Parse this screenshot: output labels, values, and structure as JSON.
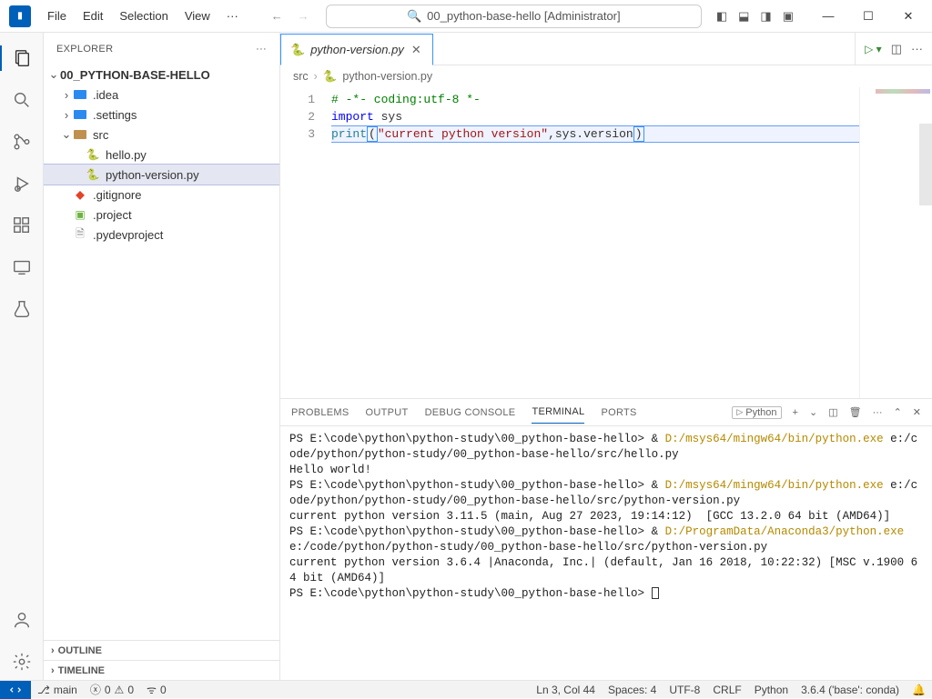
{
  "title": "00_python-base-hello [Administrator]",
  "menu": {
    "file": "File",
    "edit": "Edit",
    "selection": "Selection",
    "view": "View",
    "more": "···"
  },
  "sidebar": {
    "title": "EXPLORER",
    "root": "00_PYTHON-BASE-HELLO",
    "idea": ".idea",
    "settings": ".settings",
    "src": "src",
    "hello": "hello.py",
    "pyver": "python-version.py",
    "gitignore": ".gitignore",
    "project": ".project",
    "pydev": ".pydevproject",
    "outline": "OUTLINE",
    "timeline": "TIMELINE"
  },
  "tab": {
    "name": "python-version.py"
  },
  "breadcrumb": {
    "a": "src",
    "b": "python-version.py"
  },
  "editor": {
    "lines": [
      "1",
      "2",
      "3"
    ],
    "l1_comment": "# -*- coding:utf-8 *-",
    "l2_kw": "import",
    "l2_mod": " sys",
    "l3_fn": "print",
    "l3_open": "(",
    "l3_str": "\"current python version\"",
    "l3_mid": ",sys.version",
    "l3_close": ")"
  },
  "panel": {
    "problems": "PROBLEMS",
    "output": "OUTPUT",
    "debug": "DEBUG CONSOLE",
    "terminal": "TERMINAL",
    "ports": "PORTS",
    "launch": "Python",
    "plus": "+"
  },
  "terminal": {
    "p1a": "PS E:\\code\\python\\python-study\\00_python-base-hello> & ",
    "p1y": "D:/msys64/mingw64/bin/python.exe",
    "p1b": " e:/code/python/python-study/00_python-base-hello/src/hello.py",
    "o1": "Hello world!",
    "p2a": "PS E:\\code\\python\\python-study\\00_python-base-hello> & ",
    "p2y": "D:/msys64/mingw64/bin/python.exe",
    "p2b": " e:/code/python/python-study/00_python-base-hello/src/python-version.py",
    "o2": "current python version 3.11.5 (main, Aug 27 2023, 19:14:12)  [GCC 13.2.0 64 bit (AMD64)]",
    "p3a": "PS E:\\code\\python\\python-study\\00_python-base-hello> & ",
    "p3y": "D:/ProgramData/Anaconda3/python.exe",
    "p3b": " e:/code/python/python-study/00_python-base-hello/src/python-version.py",
    "o3": "current python version 3.6.4 |Anaconda, Inc.| (default, Jan 16 2018, 10:22:32) [MSC v.1900 64 bit (AMD64)]",
    "p4": "PS E:\\code\\python\\python-study\\00_python-base-hello> "
  },
  "status": {
    "branch": "main",
    "errors": "0",
    "warnings": "0",
    "ports": "0",
    "lncol": "Ln 3, Col 44",
    "spaces": "Spaces: 4",
    "enc": "UTF-8",
    "eol": "CRLF",
    "lang": "Python",
    "interp": "3.6.4 ('base': conda)"
  }
}
